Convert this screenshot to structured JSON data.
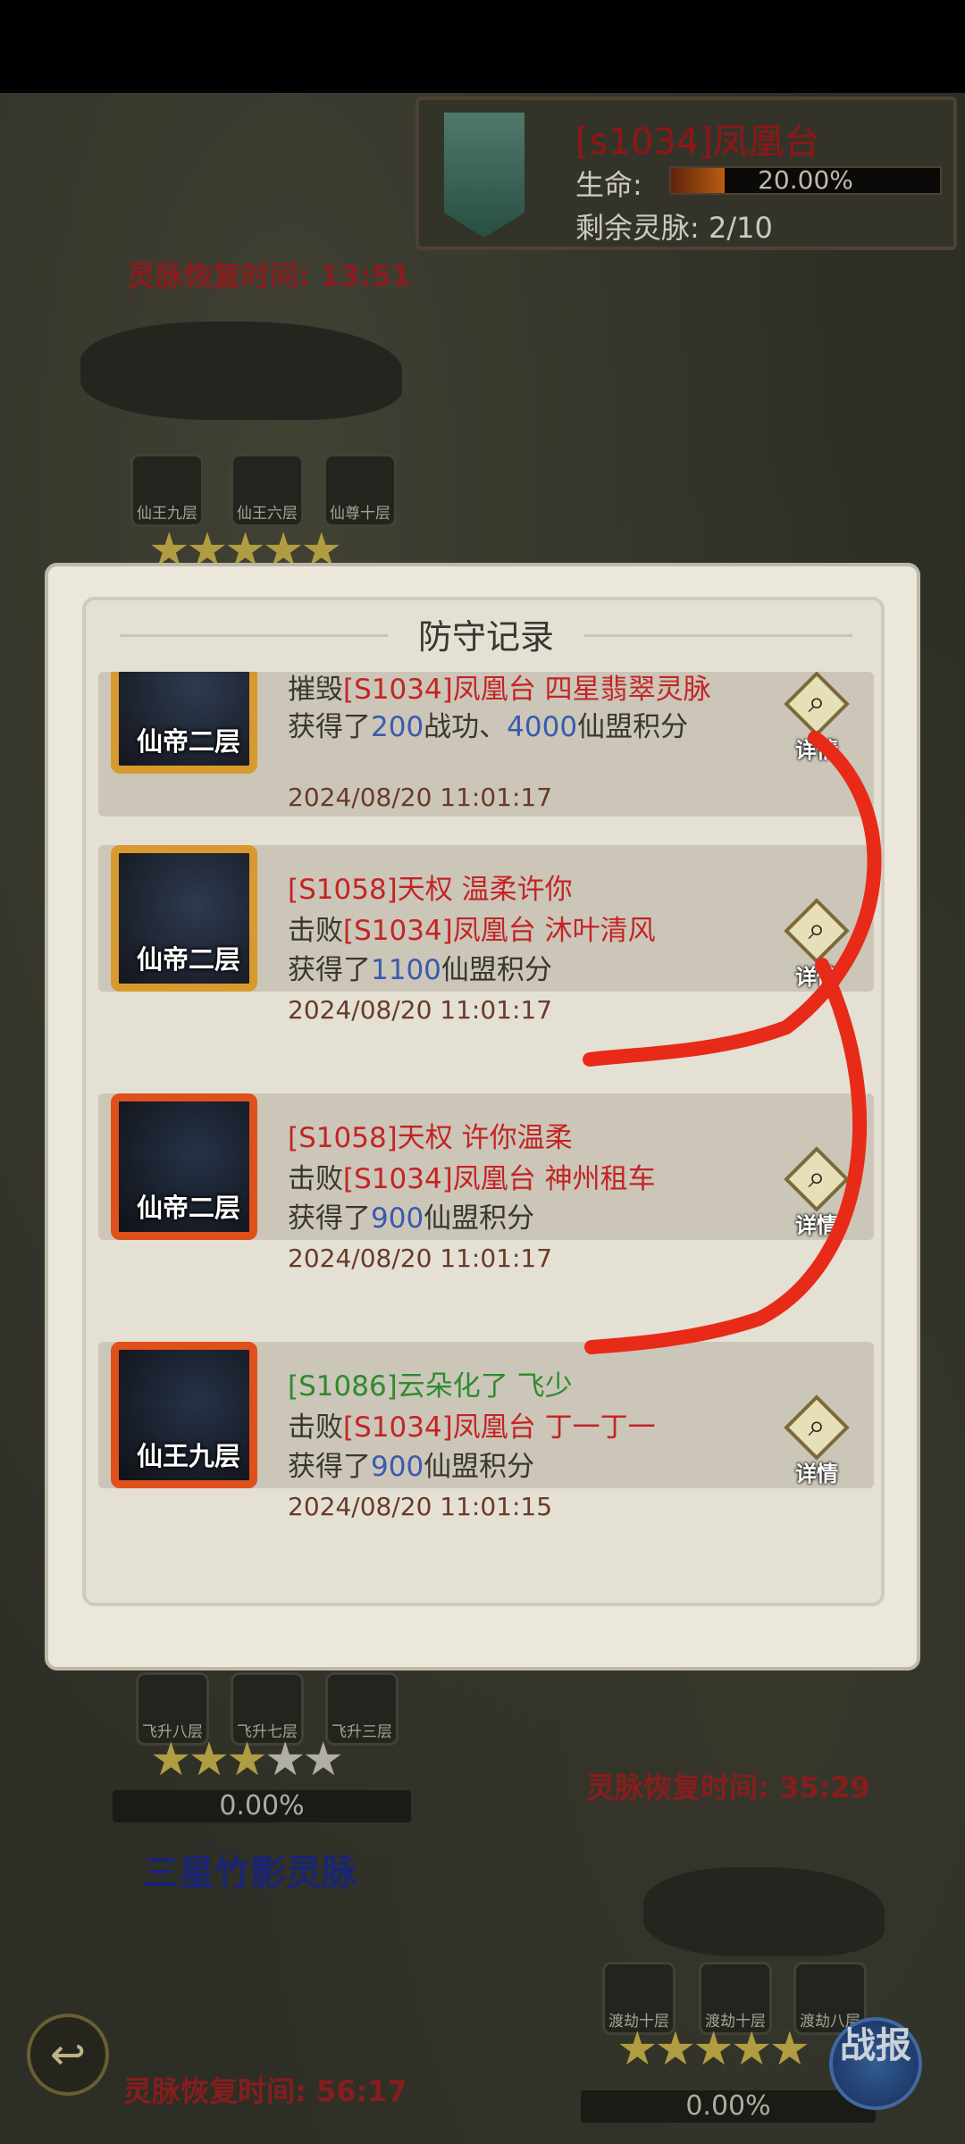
{
  "banner": {
    "title": "[s1034]凤凰台",
    "life_label": "生命:",
    "life_value": "20.00%",
    "life_fraction": 0.2,
    "vein_label": "剩余灵脉: 2/10"
  },
  "background": {
    "recover_top": "灵脉恢复时间: 13:51",
    "recover_mid": "灵脉恢复时间: 35:29",
    "recover_bottom": "灵脉恢复时间: 56:17",
    "top_avatars": [
      "仙王九层",
      "仙王六层",
      "仙尊十层"
    ],
    "mid_avatars": [
      "飞升八层",
      "飞升七层",
      "飞升三层"
    ],
    "mid_pct": "0.00%",
    "mid_vein_name": "三星竹影灵脉",
    "bottom_avatars": [
      "渡劫十层",
      "渡劫十层",
      "渡劫八层"
    ],
    "bottom_pct": "0.00%",
    "report_label": "战报"
  },
  "modal": {
    "title": "防守记录",
    "detail_label": "详情",
    "records": [
      {
        "rank": "仙帝二层",
        "line1_prefix": "摧毁",
        "line1_red": "[S1034]凤凰台 四星翡翠灵脉",
        "line2_pre": "获得了",
        "line2_num1": "200",
        "line2_mid": "战功、",
        "line2_num2": "4000",
        "line2_post": "仙盟积分",
        "time": "2024/08/20 11:01:17"
      },
      {
        "rank": "仙帝二层",
        "attacker": "[S1058]天权 温柔许你",
        "line2_pre": "击败",
        "line2_red": "[S1034]凤凰台 沐叶清风",
        "line3_pre": "获得了",
        "line3_num": "1100",
        "line3_post": "仙盟积分",
        "time": "2024/08/20 11:01:17"
      },
      {
        "rank": "仙帝二层",
        "attacker": "[S1058]天权 许你温柔",
        "line2_pre": "击败",
        "line2_red": "[S1034]凤凰台 神州租车",
        "line3_pre": "获得了",
        "line3_num": "900",
        "line3_post": "仙盟积分",
        "time": "2024/08/20 11:01:17"
      },
      {
        "rank": "仙王九层",
        "attacker": "[S1086]云朵化了 飞少",
        "line2_pre": "击败",
        "line2_red": "[S1034]凤凰台 丁一丁一",
        "line3_pre": "获得了",
        "line3_num": "900",
        "line3_post": "仙盟积分",
        "time": "2024/08/20 11:01:15"
      }
    ]
  },
  "colors": {
    "attacker_red": "#c42424",
    "attacker_green": "#2e8a2e",
    "number_blue": "#3a5ab0",
    "annotation_red": "#e82a18"
  }
}
